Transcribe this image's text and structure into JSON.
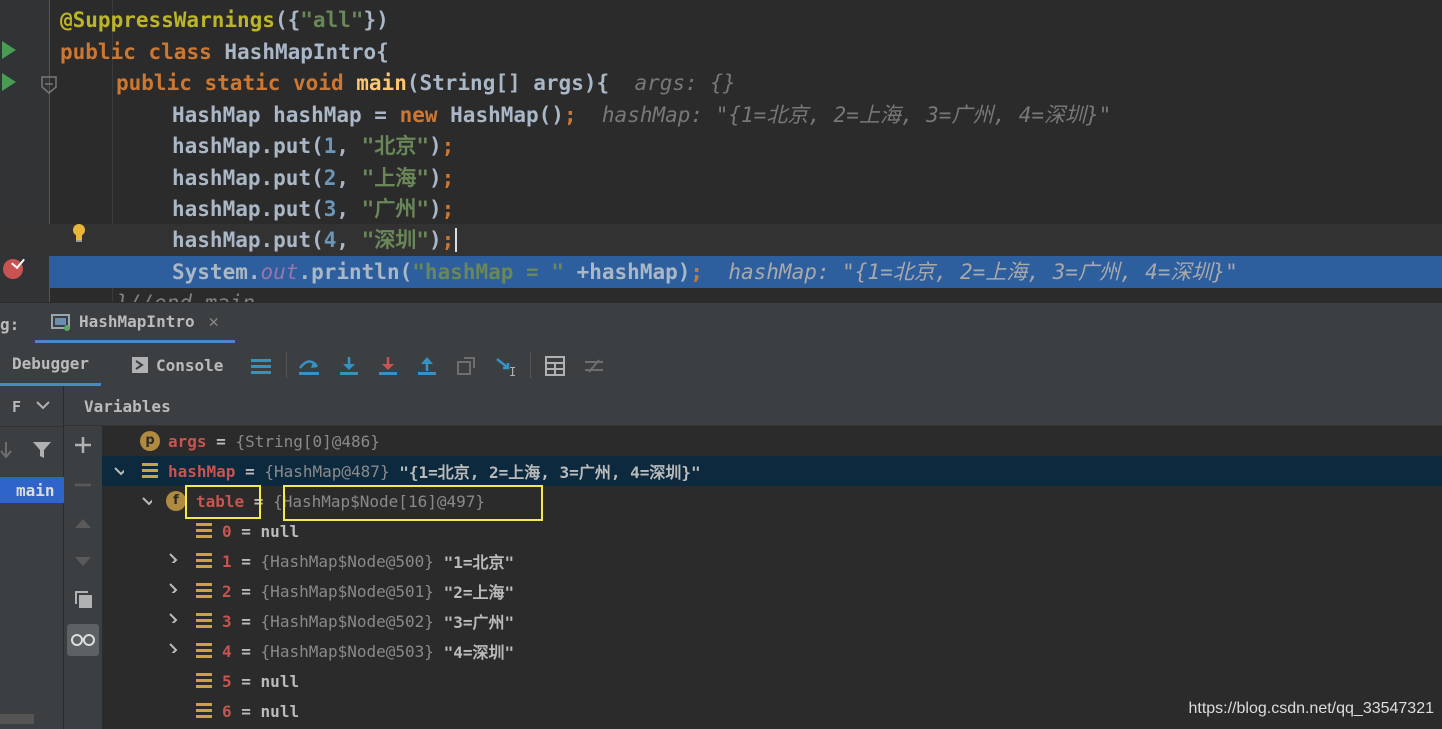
{
  "editor": {
    "line1": {
      "annotation": "@SuppressWarnings",
      "paren_open": "({",
      "str": "\"all\"",
      "paren_close": "})"
    },
    "line2": {
      "kw1": "public",
      "kw2": "class",
      "name": "HashMapIntro",
      "brace": "{"
    },
    "line3": {
      "kw1": "public",
      "kw2": "static",
      "kw3": "void",
      "fn": "main",
      "sig": "(String[] args){",
      "hint": "args: {}"
    },
    "line4": {
      "code_a": "HashMap hashMap = ",
      "kw": "new",
      "code_b": " HashMap()",
      "semi": ";",
      "hint": "hashMap: \"{1=北京, 2=上海, 3=广州, 4=深圳}\""
    },
    "line5": {
      "code": "hashMap.put(",
      "num": "1",
      "comma": ", ",
      "str": "\"北京\"",
      "close": ")",
      "semi": ";"
    },
    "line6": {
      "code": "hashMap.put(",
      "num": "2",
      "comma": ", ",
      "str": "\"上海\"",
      "close": ")",
      "semi": ";"
    },
    "line7": {
      "code": "hashMap.put(",
      "num": "3",
      "comma": ", ",
      "str": "\"广州\"",
      "close": ")",
      "semi": ";"
    },
    "line8": {
      "code": "hashMap.put(",
      "num": "4",
      "comma": ", ",
      "str": "\"深圳\"",
      "close": ")",
      "semi": ";"
    },
    "line9": {
      "code_a": "System.",
      "field": "out",
      "code_b": ".println(",
      "str": "\"hashMap = \"",
      "code_c": " +hashMap)",
      "semi": ";",
      "hint": "hashMap: \"{1=北京, 2=上海, 3=广州, 4=深圳}\""
    },
    "line10": {
      "code": "}//end main"
    }
  },
  "debug": {
    "label": "g:",
    "session_tab": "HashMapIntro",
    "tabs": {
      "debugger": "Debugger",
      "console": "Console"
    },
    "frames_label": "F",
    "frame_main": "main",
    "variables_label": "Variables"
  },
  "variables": [
    {
      "badge": "p",
      "name": "args",
      "type": "{String[0]@486}",
      "value": ""
    },
    {
      "badge": "arr",
      "name": "hashMap",
      "type": "{HashMap@487}",
      "value": "\"{1=北京, 2=上海, 3=广州, 4=深圳}\""
    },
    {
      "badge": "f",
      "name": "table",
      "type": "{HashMap$Node[16]@497}",
      "value": ""
    },
    {
      "badge": "arr",
      "name": "0",
      "type": "",
      "value": "null"
    },
    {
      "badge": "arr",
      "name": "1",
      "type": "{HashMap$Node@500}",
      "value": "\"1=北京\""
    },
    {
      "badge": "arr",
      "name": "2",
      "type": "{HashMap$Node@501}",
      "value": "\"2=上海\""
    },
    {
      "badge": "arr",
      "name": "3",
      "type": "{HashMap$Node@502}",
      "value": "\"3=广州\""
    },
    {
      "badge": "arr",
      "name": "4",
      "type": "{HashMap$Node@503}",
      "value": "\"4=深圳\""
    },
    {
      "badge": "arr",
      "name": "5",
      "type": "",
      "value": "null"
    },
    {
      "badge": "arr",
      "name": "6",
      "type": "",
      "value": "null"
    }
  ],
  "colors": {
    "accent": "#4a88c7",
    "selection": "#2d5e9e",
    "highlight_box": "#f2e94e"
  },
  "watermark": "https://blog.csdn.net/qq_33547321"
}
